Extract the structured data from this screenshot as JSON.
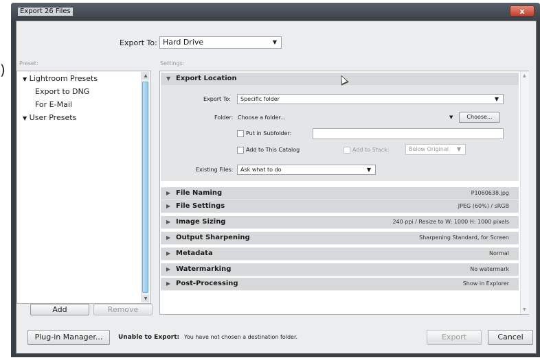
{
  "window": {
    "title": "Export 26 Files",
    "close_label": "x"
  },
  "top": {
    "export_to_label": "Export To:",
    "export_to_value": "Hard Drive"
  },
  "preset": {
    "label": "Preset:",
    "items": [
      "Lightroom Presets",
      "Export to DNG",
      "For E-Mail",
      "User Presets"
    ],
    "add_label": "Add",
    "remove_label": "Remove"
  },
  "settings": {
    "label": "Settings:",
    "export_location": {
      "title": "Export Location",
      "export_to_label": "Export To:",
      "export_to_value": "Specific folder",
      "folder_label": "Folder:",
      "folder_value": "Choose a folder...",
      "choose_label": "Choose...",
      "subfolder_label": "Put in Subfolder:",
      "add_catalog_label": "Add to This Catalog",
      "add_stack_label": "Add to Stack:",
      "stack_value": "Below Original",
      "existing_label": "Existing Files:",
      "existing_value": "Ask what to do"
    },
    "sections": [
      {
        "name": "File Naming",
        "summary": "P1060638.jpg"
      },
      {
        "name": "File Settings",
        "summary": "JPEG (60%) / sRGB"
      },
      {
        "name": "Image Sizing",
        "summary": "240 ppi / Resize to W: 1000 H: 1000 pixels"
      },
      {
        "name": "Output Sharpening",
        "summary": "Sharpening Standard, for Screen"
      },
      {
        "name": "Metadata",
        "summary": "Normal"
      },
      {
        "name": "Watermarking",
        "summary": "No watermark"
      },
      {
        "name": "Post-Processing",
        "summary": "Show in Explorer"
      }
    ]
  },
  "footer": {
    "plugin_label": "Plug-in Manager...",
    "status_bold": "Unable to Export:",
    "status_text": "You have not chosen a destination folder.",
    "export_label": "Export",
    "cancel_label": "Cancel"
  },
  "icons": {
    "expanded": "triangle-down-icon",
    "collapsed": "triangle-right-icon",
    "dropdown": "chevron-down-icon"
  }
}
